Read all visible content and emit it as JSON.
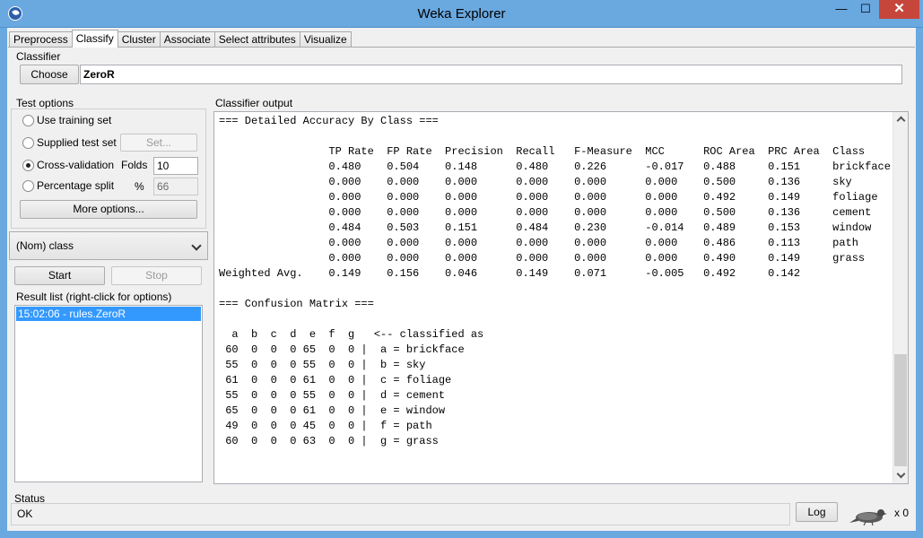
{
  "window": {
    "title": "Weka Explorer",
    "minimize": "—",
    "maximize": "☐",
    "close": "✕"
  },
  "tabs": [
    "Preprocess",
    "Classify",
    "Cluster",
    "Associate",
    "Select attributes",
    "Visualize"
  ],
  "classifier": {
    "group_label": "Classifier",
    "choose_label": "Choose",
    "name": "ZeroR"
  },
  "test_options": {
    "group_label": "Test options",
    "use_training": "Use training set",
    "supplied": "Supplied test set",
    "set_button": "Set...",
    "cross_validation": "Cross-validation",
    "folds_label": "Folds",
    "folds_value": "10",
    "percentage": "Percentage split",
    "percent_sign": "%",
    "percent_value": "66",
    "more_options": "More options...",
    "selected": "cross_validation"
  },
  "class_select": {
    "value": "(Nom) class"
  },
  "actions": {
    "start": "Start",
    "stop": "Stop"
  },
  "result_list": {
    "label": "Result list (right-click for options)",
    "items": [
      "15:02:06 - rules.ZeroR"
    ]
  },
  "output": {
    "label": "Classifier output",
    "text": "=== Detailed Accuracy By Class ===\n\n                 TP Rate  FP Rate  Precision  Recall   F-Measure  MCC      ROC Area  PRC Area  Class\n                 0.480    0.504    0.148      0.480    0.226      -0.017   0.488     0.151     brickface\n                 0.000    0.000    0.000      0.000    0.000      0.000    0.500     0.136     sky\n                 0.000    0.000    0.000      0.000    0.000      0.000    0.492     0.149     foliage\n                 0.000    0.000    0.000      0.000    0.000      0.000    0.500     0.136     cement\n                 0.484    0.503    0.151      0.484    0.230      -0.014   0.489     0.153     window\n                 0.000    0.000    0.000      0.000    0.000      0.000    0.486     0.113     path\n                 0.000    0.000    0.000      0.000    0.000      0.000    0.490     0.149     grass\nWeighted Avg.    0.149    0.156    0.046      0.149    0.071      -0.005   0.492     0.142\n\n=== Confusion Matrix ===\n\n  a  b  c  d  e  f  g   <-- classified as\n 60  0  0  0 65  0  0 |  a = brickface\n 55  0  0  0 55  0  0 |  b = sky\n 61  0  0  0 61  0  0 |  c = foliage\n 55  0  0  0 55  0  0 |  d = cement\n 65  0  0  0 61  0  0 |  e = window\n 49  0  0  0 45  0  0 |  f = path\n 60  0  0  0 63  0  0 |  g = grass"
  },
  "status": {
    "label": "Status",
    "text": "OK",
    "log_button": "Log",
    "count": "x 0"
  }
}
